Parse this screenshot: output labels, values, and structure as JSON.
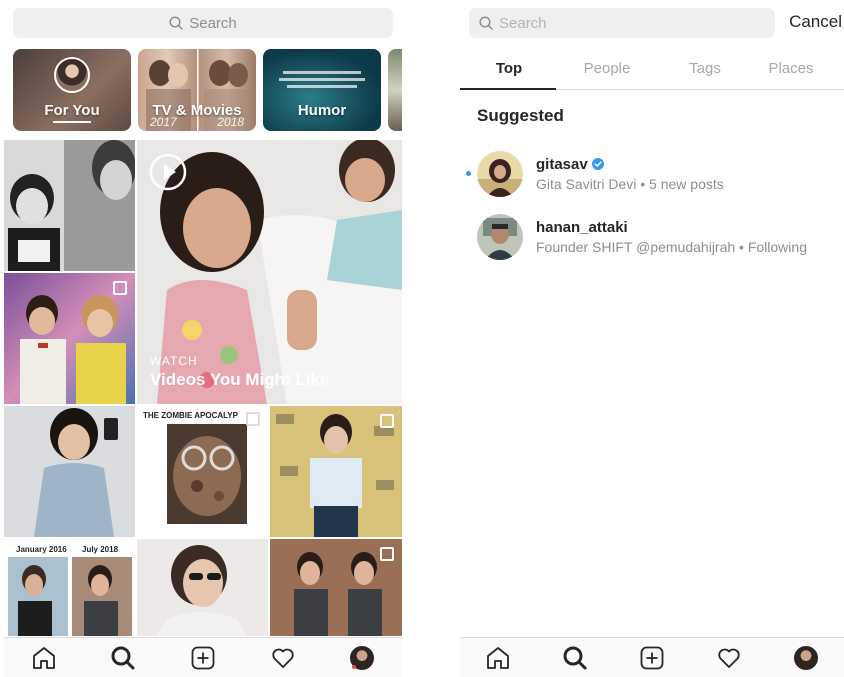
{
  "left": {
    "search_placeholder": "Search",
    "categories": [
      {
        "label": "For You"
      },
      {
        "label": "TV & Movies",
        "years": [
          "2017",
          "2018"
        ]
      },
      {
        "label": "Humor"
      }
    ],
    "watch": {
      "eyebrow": "WATCH",
      "title": "Videos You Might Like"
    },
    "captions": {
      "zombie": "THE ZOMBIE APOCALYP",
      "before": "January 2016",
      "after": "July 2018"
    }
  },
  "right": {
    "search_placeholder": "Search",
    "cancel_label": "Cancel",
    "tabs": [
      "Top",
      "People",
      "Tags",
      "Places"
    ],
    "section_title": "Suggested",
    "results": [
      {
        "username": "gitasav",
        "subtitle": "Gita Savitri Devi • 5 new posts",
        "verified": true,
        "unread": true
      },
      {
        "username": "hanan_attaki",
        "subtitle": "Founder SHIFT @pemudahijrah • Following",
        "verified": false,
        "unread": false
      }
    ]
  },
  "tabbar": [
    "home-icon",
    "search-icon",
    "new-post-icon",
    "activity-icon",
    "profile-icon"
  ],
  "colors": {
    "accent": "#3897f0",
    "text": "#262626",
    "muted": "#8e8e8e",
    "divider": "#dbdbdb",
    "notify": "#ed4956"
  }
}
